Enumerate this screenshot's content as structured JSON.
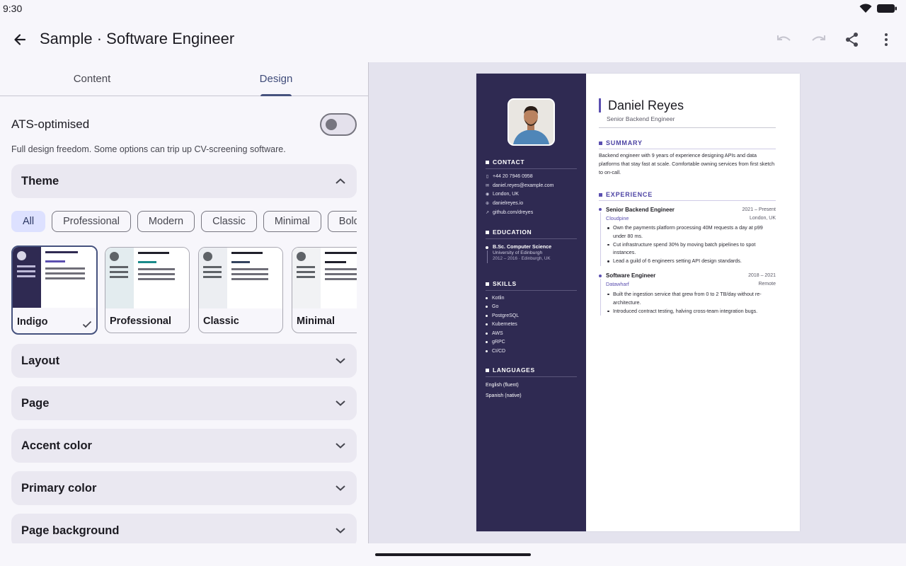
{
  "status": {
    "time": "9:30"
  },
  "appbar": {
    "title": "Sample · Software Engineer"
  },
  "tabs": [
    {
      "label": "Content"
    },
    {
      "label": "Design"
    }
  ],
  "ats": {
    "label": "ATS-optimised",
    "enabled": false,
    "help": "Full design freedom. Some options can trip up CV-screening software."
  },
  "sections": {
    "theme": "Theme",
    "layout": "Layout",
    "page": "Page",
    "accent": "Accent color",
    "primary": "Primary color",
    "background": "Page background"
  },
  "chips": [
    "All",
    "Professional",
    "Modern",
    "Classic",
    "Minimal",
    "Bold"
  ],
  "themes": [
    {
      "name": "Indigo",
      "selected": true
    },
    {
      "name": "Professional",
      "selected": false
    },
    {
      "name": "Classic",
      "selected": false
    },
    {
      "name": "Minimal",
      "selected": false
    }
  ],
  "colors": {
    "accent": "#5b4fb0",
    "sidebar": "#2f2a52",
    "chip_selected": "#dde1ff",
    "primary_ui": "#46527e"
  },
  "cv": {
    "name": "Daniel Reyes",
    "role": "Senior Backend Engineer",
    "contact_h": "CONTACT",
    "contact": [
      {
        "icon": "phone-icon",
        "text": "+44 20 7946 0958"
      },
      {
        "icon": "mail-icon",
        "text": "daniel.reyes@example.com"
      },
      {
        "icon": "location-icon",
        "text": "London, UK"
      },
      {
        "icon": "globe-icon",
        "text": "danielreyes.io"
      },
      {
        "icon": "link-icon",
        "text": "github.com/dreyes"
      }
    ],
    "education_h": "EDUCATION",
    "education": {
      "degree": "B.Sc. Computer Science",
      "school": "University of Edinburgh",
      "dates": "2012 – 2016 · Edinburgh, UK"
    },
    "skills_h": "SKILLS",
    "skills": [
      "Kotlin",
      "Go",
      "PostgreSQL",
      "Kubernetes",
      "AWS",
      "gRPC",
      "CI/CD"
    ],
    "languages_h": "LANGUAGES",
    "languages": [
      "English (fluent)",
      "Spanish (native)"
    ],
    "summary_h": "SUMMARY",
    "summary": "Backend engineer with 9 years of experience designing APIs and data platforms that stay fast at scale. Comfortable owning services from first sketch to on-call.",
    "experience_h": "EXPERIENCE",
    "jobs": [
      {
        "title": "Senior Backend Engineer",
        "dates": "2021 – Present",
        "company": "Cloudpine",
        "location": "London, UK",
        "bullets": [
          "Own the payments platform processing 40M requests a day at p99 under 80 ms.",
          "Cut infrastructure spend 30% by moving batch pipelines to spot instances.",
          "Lead a guild of 6 engineers setting API design standards."
        ]
      },
      {
        "title": "Software Engineer",
        "dates": "2018 – 2021",
        "company": "Datawharf",
        "location": "Remote",
        "bullets": [
          "Built the ingestion service that grew from 0 to 2 TB/day without re-architecture.",
          "Introduced contract testing, halving cross-team integration bugs."
        ]
      }
    ]
  }
}
